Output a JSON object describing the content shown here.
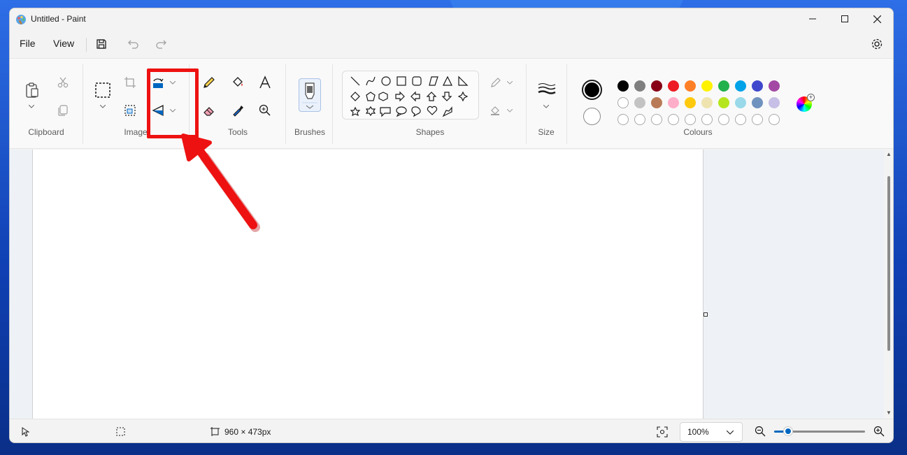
{
  "window": {
    "title": "Untitled - Paint"
  },
  "menu": {
    "file": "File",
    "view": "View"
  },
  "ribbon": {
    "groups": {
      "clipboard": "Clipboard",
      "image": "Image",
      "tools": "Tools",
      "brushes": "Brushes",
      "shapes": "Shapes",
      "size": "Size",
      "colours": "Colours"
    },
    "palette_row1": [
      "#000000",
      "#7f7f7f",
      "#880015",
      "#ed1c24",
      "#ff7f27",
      "#fff200",
      "#22b14c",
      "#00a2e8",
      "#3f48cc",
      "#a349a4"
    ],
    "palette_row2": [
      "#ffffff",
      "#c3c3c3",
      "#b97a57",
      "#ffaec9",
      "#ffc90e",
      "#efe4b0",
      "#b5e61d",
      "#99d9ea",
      "#7092be",
      "#c8bfe7"
    ],
    "palette_row3_count": 10,
    "primary_color": "#000000",
    "secondary_color": "#ffffff"
  },
  "status": {
    "canvas_size": "960 × 473px",
    "zoom": "100%",
    "zoom_slider_fraction": 0.15
  },
  "annotation": {
    "highlight_color": "#ee1111"
  }
}
